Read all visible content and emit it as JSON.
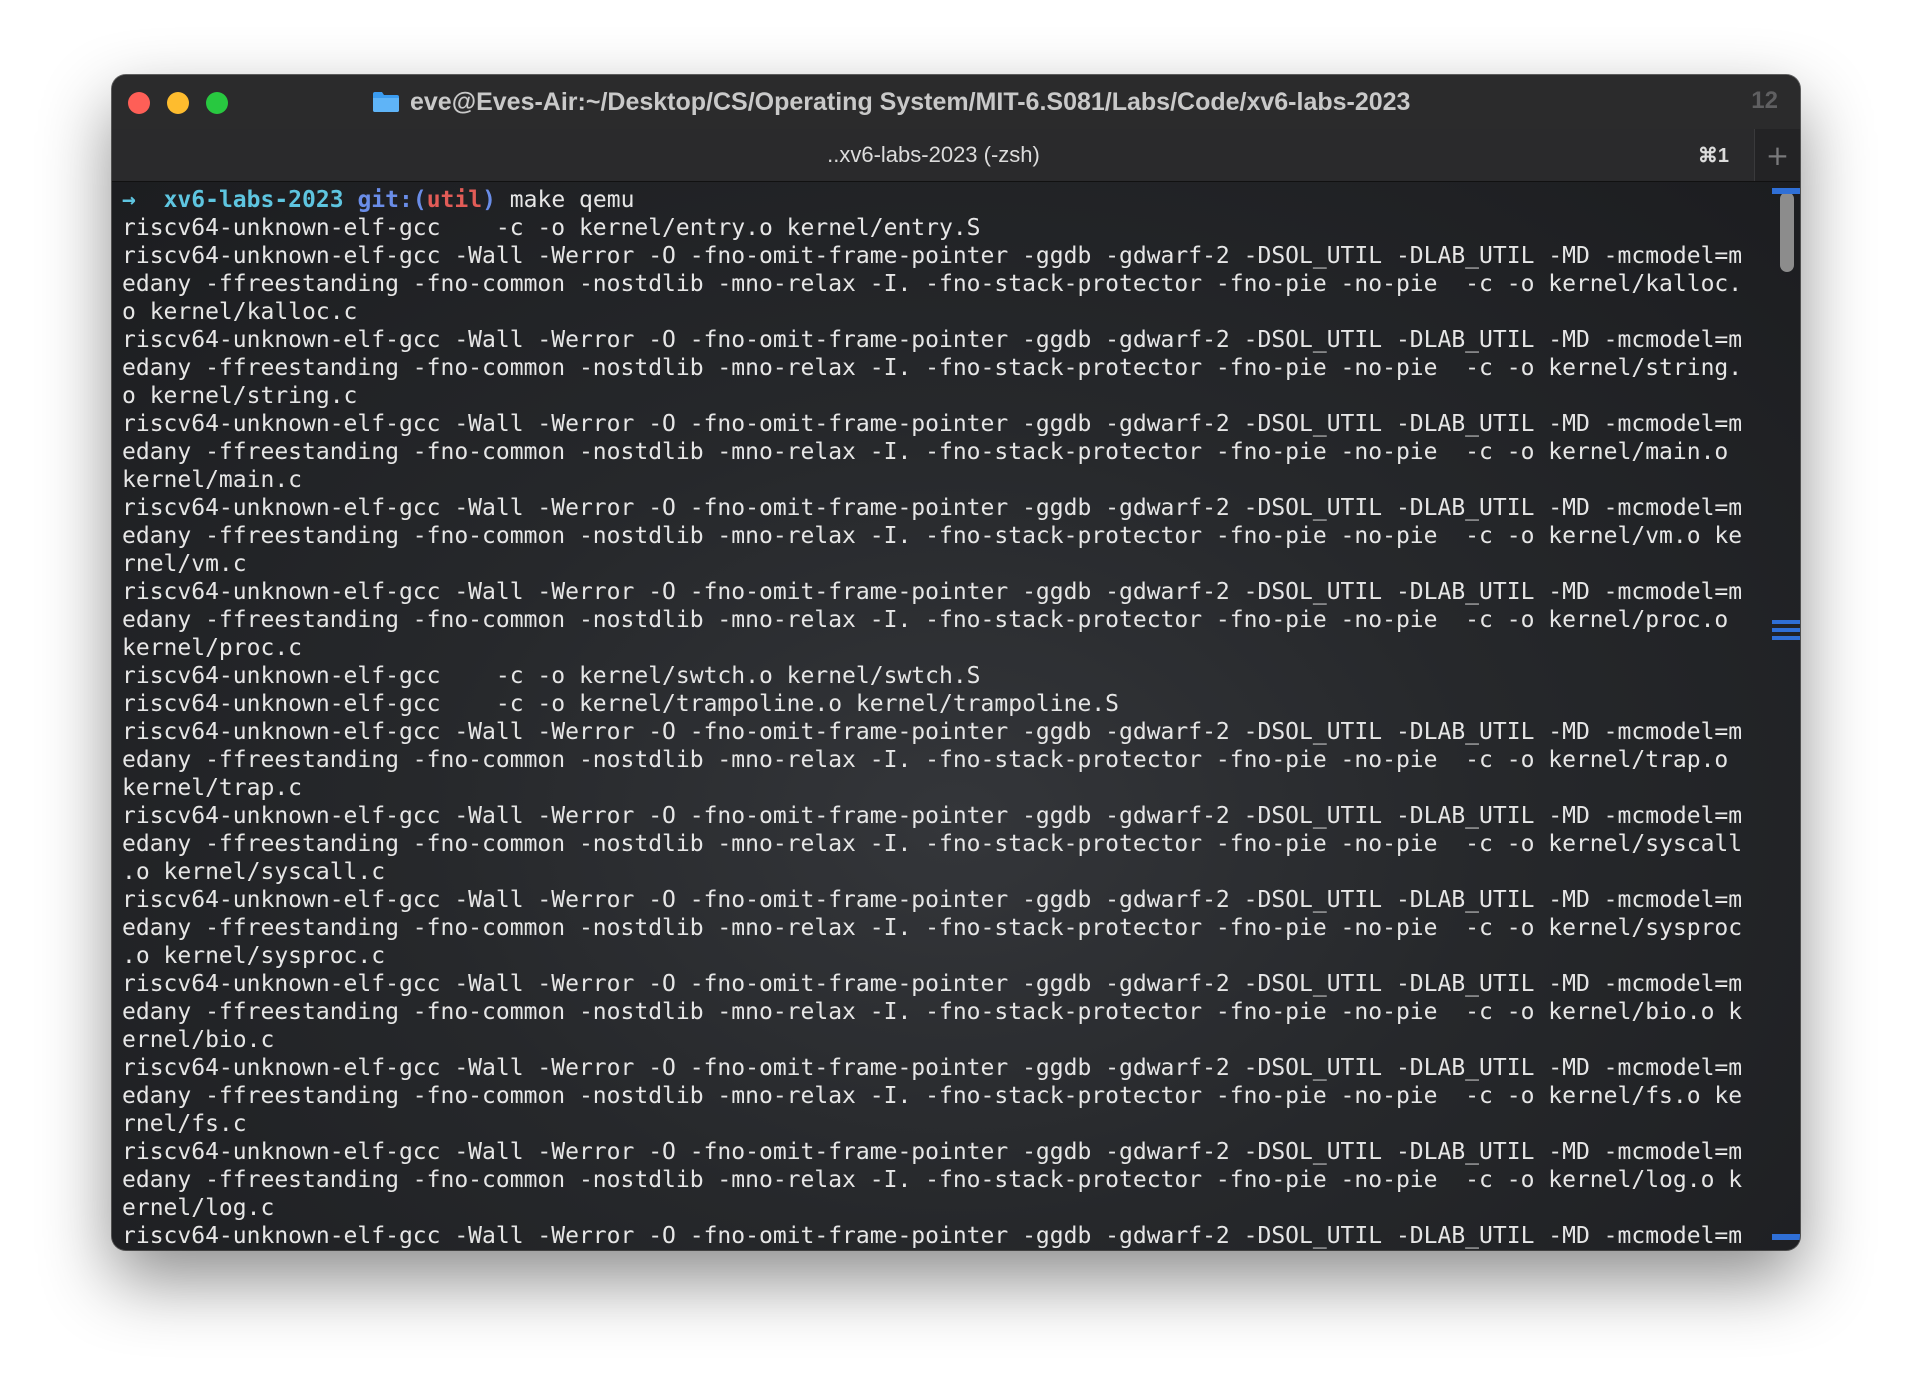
{
  "window": {
    "title": "eve@Eves-Air:~/Desktop/CS/Operating System/MIT-6.S081/Labs/Code/xv6-labs-2023",
    "count": "12"
  },
  "tab": {
    "label": "..xv6-labs-2023 (-zsh)",
    "shortcut": "⌘1",
    "new_tab": "+"
  },
  "prompt": {
    "arrow": "→",
    "dir": "xv6-labs-2023",
    "git": "git:(",
    "branch": "util",
    "git_close": ")",
    "command": "make qemu"
  },
  "output_lines": [
    "riscv64-unknown-elf-gcc    -c -o kernel/entry.o kernel/entry.S",
    "riscv64-unknown-elf-gcc -Wall -Werror -O -fno-omit-frame-pointer -ggdb -gdwarf-2 -DSOL_UTIL -DLAB_UTIL -MD -mcmodel=m",
    "edany -ffreestanding -fno-common -nostdlib -mno-relax -I. -fno-stack-protector -fno-pie -no-pie  -c -o kernel/kalloc.",
    "o kernel/kalloc.c",
    "riscv64-unknown-elf-gcc -Wall -Werror -O -fno-omit-frame-pointer -ggdb -gdwarf-2 -DSOL_UTIL -DLAB_UTIL -MD -mcmodel=m",
    "edany -ffreestanding -fno-common -nostdlib -mno-relax -I. -fno-stack-protector -fno-pie -no-pie  -c -o kernel/string.",
    "o kernel/string.c",
    "riscv64-unknown-elf-gcc -Wall -Werror -O -fno-omit-frame-pointer -ggdb -gdwarf-2 -DSOL_UTIL -DLAB_UTIL -MD -mcmodel=m",
    "edany -ffreestanding -fno-common -nostdlib -mno-relax -I. -fno-stack-protector -fno-pie -no-pie  -c -o kernel/main.o",
    "kernel/main.c",
    "riscv64-unknown-elf-gcc -Wall -Werror -O -fno-omit-frame-pointer -ggdb -gdwarf-2 -DSOL_UTIL -DLAB_UTIL -MD -mcmodel=m",
    "edany -ffreestanding -fno-common -nostdlib -mno-relax -I. -fno-stack-protector -fno-pie -no-pie  -c -o kernel/vm.o ke",
    "rnel/vm.c",
    "riscv64-unknown-elf-gcc -Wall -Werror -O -fno-omit-frame-pointer -ggdb -gdwarf-2 -DSOL_UTIL -DLAB_UTIL -MD -mcmodel=m",
    "edany -ffreestanding -fno-common -nostdlib -mno-relax -I. -fno-stack-protector -fno-pie -no-pie  -c -o kernel/proc.o",
    "kernel/proc.c",
    "riscv64-unknown-elf-gcc    -c -o kernel/swtch.o kernel/swtch.S",
    "riscv64-unknown-elf-gcc    -c -o kernel/trampoline.o kernel/trampoline.S",
    "riscv64-unknown-elf-gcc -Wall -Werror -O -fno-omit-frame-pointer -ggdb -gdwarf-2 -DSOL_UTIL -DLAB_UTIL -MD -mcmodel=m",
    "edany -ffreestanding -fno-common -nostdlib -mno-relax -I. -fno-stack-protector -fno-pie -no-pie  -c -o kernel/trap.o",
    "kernel/trap.c",
    "riscv64-unknown-elf-gcc -Wall -Werror -O -fno-omit-frame-pointer -ggdb -gdwarf-2 -DSOL_UTIL -DLAB_UTIL -MD -mcmodel=m",
    "edany -ffreestanding -fno-common -nostdlib -mno-relax -I. -fno-stack-protector -fno-pie -no-pie  -c -o kernel/syscall",
    ".o kernel/syscall.c",
    "riscv64-unknown-elf-gcc -Wall -Werror -O -fno-omit-frame-pointer -ggdb -gdwarf-2 -DSOL_UTIL -DLAB_UTIL -MD -mcmodel=m",
    "edany -ffreestanding -fno-common -nostdlib -mno-relax -I. -fno-stack-protector -fno-pie -no-pie  -c -o kernel/sysproc",
    ".o kernel/sysproc.c",
    "riscv64-unknown-elf-gcc -Wall -Werror -O -fno-omit-frame-pointer -ggdb -gdwarf-2 -DSOL_UTIL -DLAB_UTIL -MD -mcmodel=m",
    "edany -ffreestanding -fno-common -nostdlib -mno-relax -I. -fno-stack-protector -fno-pie -no-pie  -c -o kernel/bio.o k",
    "ernel/bio.c",
    "riscv64-unknown-elf-gcc -Wall -Werror -O -fno-omit-frame-pointer -ggdb -gdwarf-2 -DSOL_UTIL -DLAB_UTIL -MD -mcmodel=m",
    "edany -ffreestanding -fno-common -nostdlib -mno-relax -I. -fno-stack-protector -fno-pie -no-pie  -c -o kernel/fs.o ke",
    "rnel/fs.c",
    "riscv64-unknown-elf-gcc -Wall -Werror -O -fno-omit-frame-pointer -ggdb -gdwarf-2 -DSOL_UTIL -DLAB_UTIL -MD -mcmodel=m",
    "edany -ffreestanding -fno-common -nostdlib -mno-relax -I. -fno-stack-protector -fno-pie -no-pie  -c -o kernel/log.o k",
    "ernel/log.c",
    "riscv64-unknown-elf-gcc -Wall -Werror -O -fno-omit-frame-pointer -ggdb -gdwarf-2 -DSOL_UTIL -DLAB_UTIL -MD -mcmodel=m"
  ],
  "icons": {
    "folder": "folder-icon",
    "close": "close-button",
    "minimize": "minimize-button",
    "zoom": "zoom-button"
  },
  "colors": {
    "traffic_red": "#fe5f57",
    "traffic_yellow": "#febc2e",
    "traffic_green": "#28c840",
    "prompt_cyan": "#5ec5e0",
    "git_blue": "#6a8de8",
    "branch_red": "#e25c57",
    "mark_blue": "#2f6fd6"
  }
}
